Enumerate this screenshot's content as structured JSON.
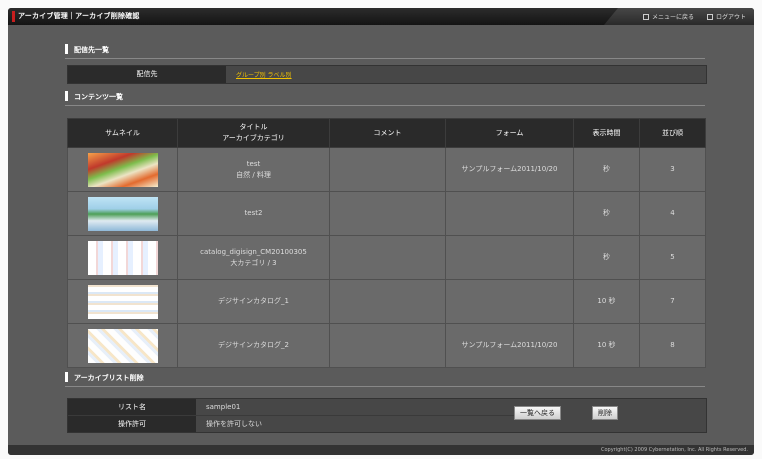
{
  "header": {
    "title": "アーカイブ管理｜アーカイブ削除確認",
    "menu_label": "メニューに戻る",
    "logout_label": "ログアウト"
  },
  "destination": {
    "section_title": "配信先一覧",
    "label": "配信先",
    "value": "グループ別 ラベル別"
  },
  "contents": {
    "section_title": "コンテンツ一覧",
    "headers": {
      "thumbnail": "サムネイル",
      "title_line1": "タイトル",
      "title_line2": "アーカイブカテゴリ",
      "comment": "コメント",
      "form": "フォーム",
      "display_time": "表示時間",
      "order": "並び順"
    },
    "rows": [
      {
        "title": "test",
        "category": "自然 / 料理",
        "comment": "",
        "form": "サンプルフォーム2011/10/20",
        "time": "秒",
        "order": "3"
      },
      {
        "title": "test2",
        "category": "",
        "comment": "",
        "form": "",
        "time": "秒",
        "order": "4"
      },
      {
        "title": "catalog_digisign_CM20100305",
        "category": "大カテゴリ / 3",
        "comment": "",
        "form": "",
        "time": "秒",
        "order": "5"
      },
      {
        "title": "デジサインカタログ_1",
        "category": "",
        "comment": "",
        "form": "",
        "time": "10 秒",
        "order": "7"
      },
      {
        "title": "デジサインカタログ_2",
        "category": "",
        "comment": "",
        "form": "サンプルフォーム2011/10/20",
        "time": "10 秒",
        "order": "8"
      }
    ]
  },
  "delete": {
    "section_title": "アーカイブリスト削除",
    "list_name_label": "リスト名",
    "list_name_value": "sample01",
    "permission_label": "操作許可",
    "permission_value": "操作を許可しない",
    "back_button": "一覧へ戻る",
    "delete_button": "削除"
  },
  "footer": {
    "copyright": "Copyright(C) 2009 Cybernetation, Inc. All Rights Reserved."
  }
}
